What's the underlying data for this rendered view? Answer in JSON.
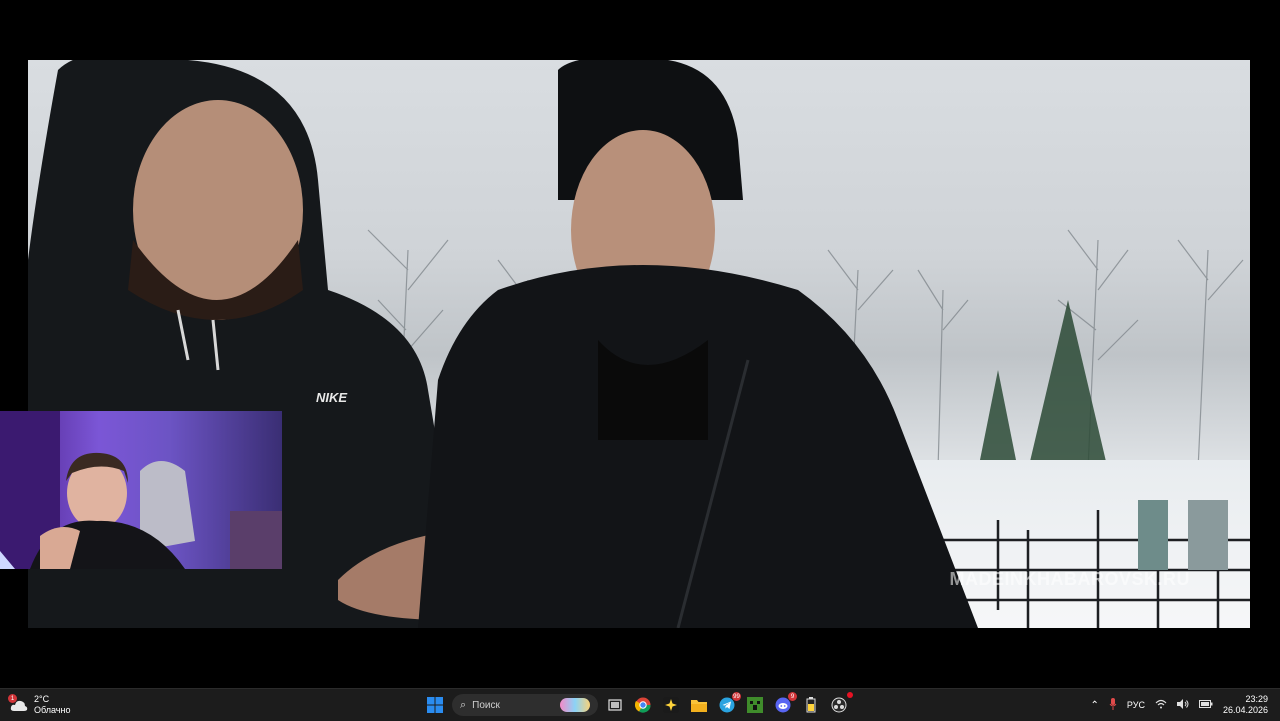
{
  "video": {
    "watermark": "MADEINKHABAROVSK.RU",
    "jacket_logo": "NIKE"
  },
  "taskbar": {
    "weather": {
      "temp": "2°C",
      "condition": "Облачно",
      "alert_count": "1"
    },
    "search": {
      "placeholder": "Поиск"
    },
    "badges": {
      "telegram": "99",
      "discord": "9"
    },
    "tray": {
      "language": "РУС"
    },
    "clock": {
      "time": "23:29",
      "date": "26.04.2026"
    }
  },
  "colors": {
    "taskbar": "#1c1c1c",
    "webcam_light": "#7b56d6",
    "start_blue": "#2a8cf0"
  },
  "icons": [
    "start-icon",
    "search-icon",
    "copilot-icon",
    "task-view-icon",
    "chrome-icon",
    "app-star-icon",
    "file-explorer-icon",
    "telegram-icon",
    "minecraft-icon",
    "discord-icon",
    "battery-app-icon",
    "obs-icon",
    "chevron-up-icon",
    "microphone-icon",
    "wifi-icon",
    "volume-icon",
    "battery-icon"
  ]
}
